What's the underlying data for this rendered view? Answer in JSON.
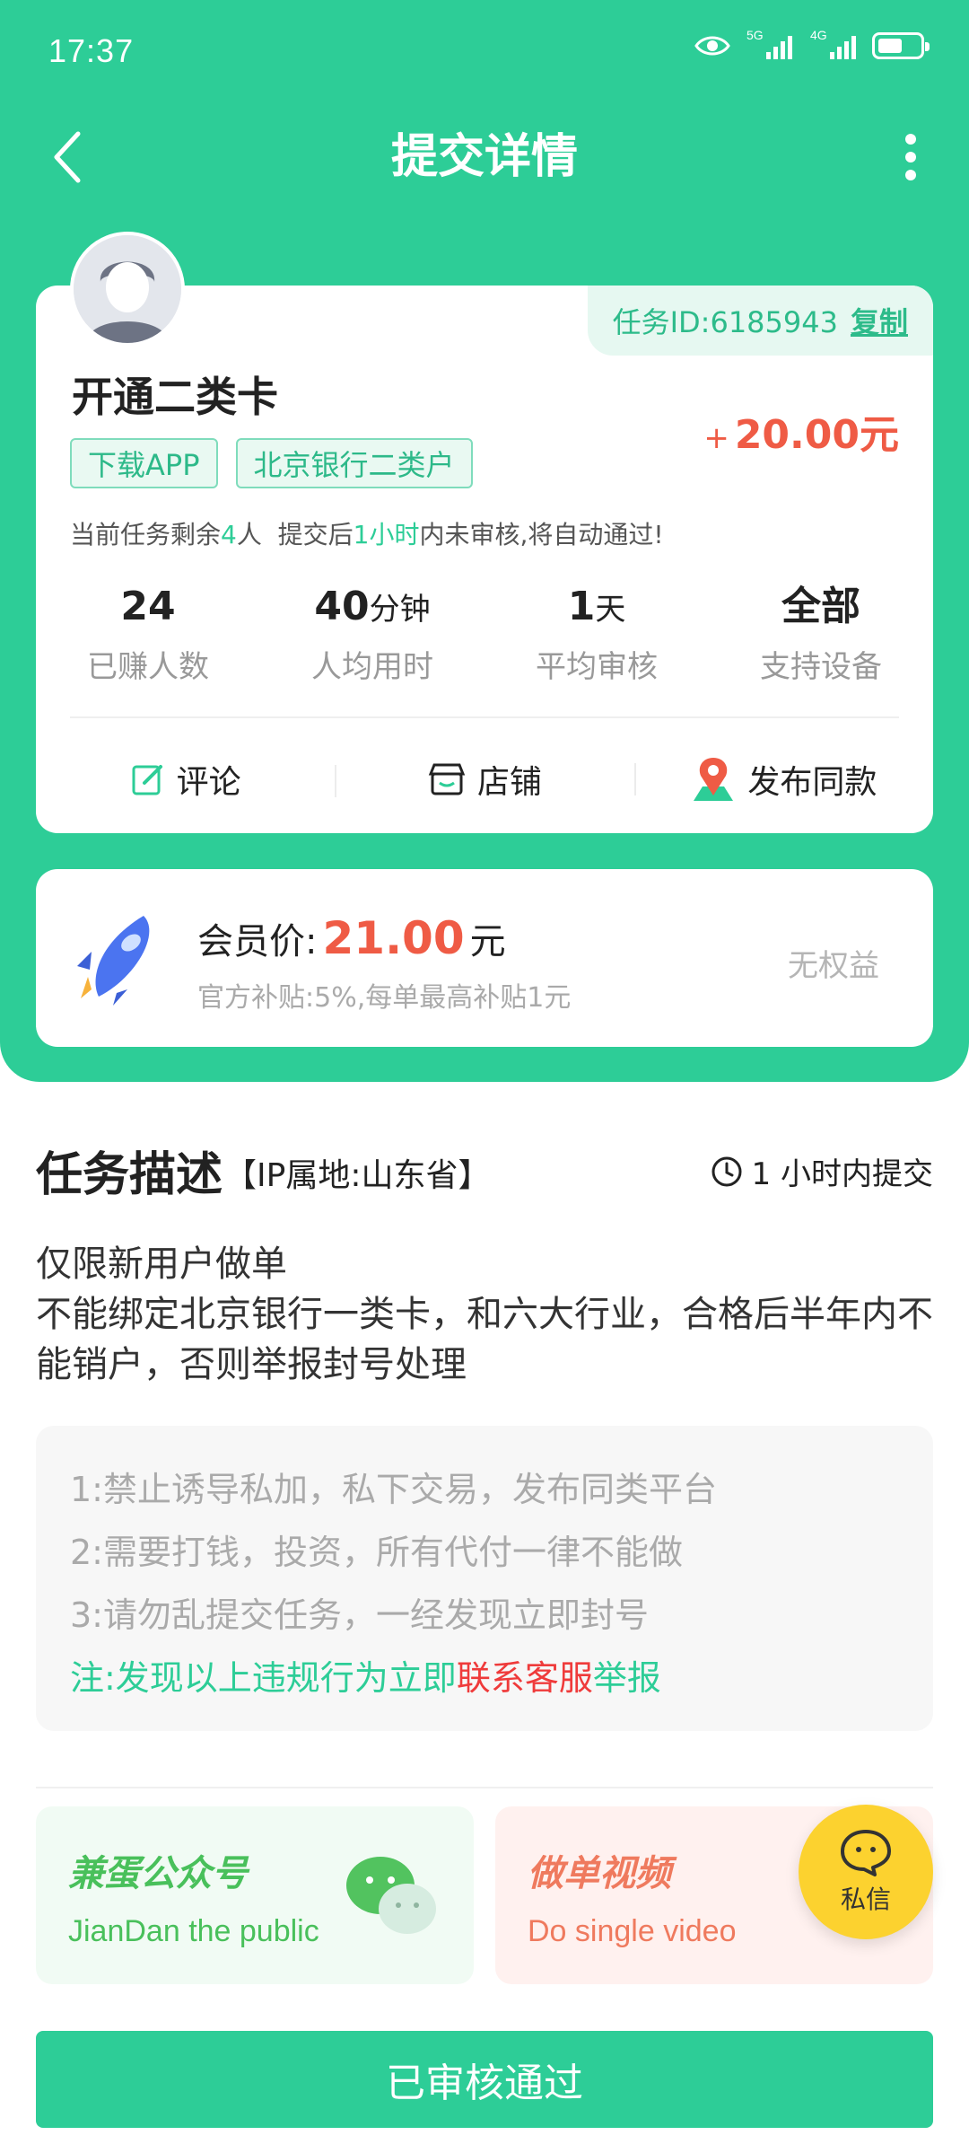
{
  "status_bar": {
    "time": "17:37",
    "net1": "5G",
    "net2": "4G",
    "battery_level": 0.6
  },
  "nav": {
    "title": "提交详情"
  },
  "task": {
    "id_label": "任务ID:6185943",
    "copy_label": "复制",
    "title": "开通二类卡",
    "price_prefix": "+",
    "price": "20.00元",
    "tags": [
      "下载APP",
      "北京银行二类户"
    ],
    "notice": {
      "p1": "当前任务剩余",
      "remaining": "4",
      "p2": "人  提交后",
      "time": "1小时",
      "p3": "内未审核,将自动通过!"
    },
    "stats": [
      {
        "num": "24",
        "unit": "",
        "label": "已赚人数"
      },
      {
        "num": "40",
        "unit": "分钟",
        "label": "人均用时"
      },
      {
        "num": "1",
        "unit": "天",
        "label": "平均审核"
      },
      {
        "num": "全部",
        "unit": "",
        "label": "支持设备"
      }
    ],
    "actions": [
      {
        "label": "评论",
        "icon": "edit-icon"
      },
      {
        "label": "店铺",
        "icon": "store-icon"
      },
      {
        "label": "发布同款",
        "icon": "location-pin-icon"
      }
    ]
  },
  "vip": {
    "label": "会员价:",
    "price": "21.00",
    "unit": "元",
    "sub": "官方补贴:5%,每单最高补贴1元",
    "right": "无权益"
  },
  "description": {
    "title": "任务描述",
    "ip": "【IP属地:山东省】",
    "deadline": "1 小时内提交",
    "body_lines": [
      "仅限新用户做单",
      "不能绑定北京银行一类卡，和六大行业，合格后半年内不能销户，否则举报封号处理"
    ],
    "rules": [
      "1:禁止诱导私加，私下交易，发布同类平台",
      "2:需要打钱，投资，所有代付一律不能做",
      "3:请勿乱提交任务，一经发现立即封号"
    ],
    "note": {
      "p1": "注:发现以上违规行为立即",
      "red": "联系客服",
      "p2": "举报"
    }
  },
  "promos": [
    {
      "title": "兼蛋公众号",
      "sub": "JianDan the public"
    },
    {
      "title": "做单视频",
      "sub": "Do single video"
    }
  ],
  "dm": {
    "label": "私信"
  },
  "submit": {
    "label": "已审核通过"
  },
  "colors": {
    "primary": "#2dcd97",
    "price_red": "#ef5b45",
    "note_red": "#ef3b3b",
    "dm_yellow": "#fcd22f"
  }
}
